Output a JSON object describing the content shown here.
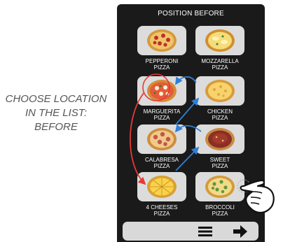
{
  "caption": {
    "line1": "CHOOSE LOCATION",
    "line2": "IN THE LIST:",
    "line3": "BEFORE"
  },
  "screen": {
    "title": "POSITION BEFORE",
    "items": [
      {
        "line1": "PEPPERONI",
        "line2": "PIZZA",
        "icon": "pepperoni-pizza-icon"
      },
      {
        "line1": "MOZZARELLA",
        "line2": "PIZZA",
        "icon": "mozzarella-pizza-icon"
      },
      {
        "line1": "MARGUERITA",
        "line2": "PIZZA",
        "icon": "marguerita-pizza-icon",
        "selected": true
      },
      {
        "line1": "CHICKEN",
        "line2": "PIZZA",
        "icon": "chicken-pizza-icon"
      },
      {
        "line1": "CALABRESA",
        "line2": "PIZZA",
        "icon": "calabresa-pizza-icon"
      },
      {
        "line1": "SWEET",
        "line2": "PIZZA",
        "icon": "sweet-pizza-icon"
      },
      {
        "line1": "4 CHEESES",
        "line2": "PIZZA",
        "icon": "four-cheeses-pizza-icon"
      },
      {
        "line1": "BROCCOLI",
        "line2": "PIZZA",
        "icon": "broccoli-pizza-icon"
      }
    ],
    "bottom_bar": {
      "menu_icon": "hamburger-menu-icon",
      "next_icon": "arrow-right-icon"
    }
  },
  "colors": {
    "screen_bg": "#1a1a1a",
    "tile_bg": "#dcdcdc",
    "move_arrow": "#e53935",
    "shift_arrow": "#2f7fd6",
    "text": "#ffffff",
    "caption": "#555555"
  }
}
